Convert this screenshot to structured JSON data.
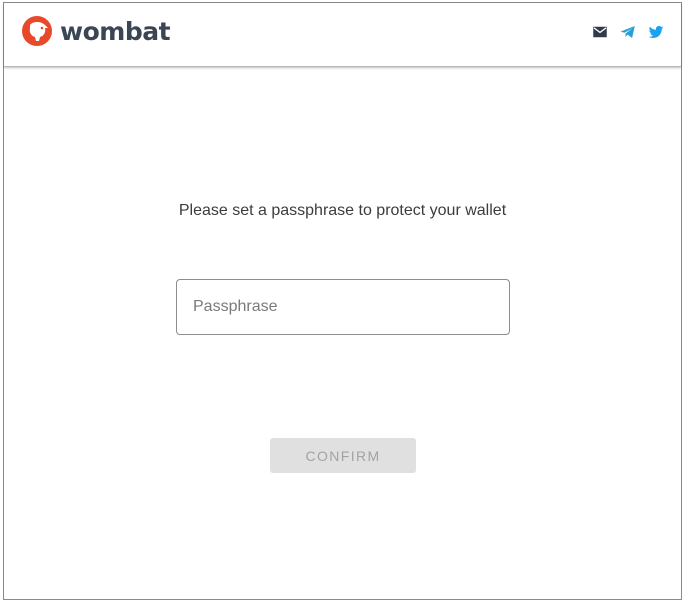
{
  "header": {
    "brand": "wombat",
    "social": [
      {
        "icon": "mail-icon",
        "color": "#2f3a4a"
      },
      {
        "icon": "telegram-icon",
        "color": "#2a9fd6"
      },
      {
        "icon": "twitter-icon",
        "color": "#1da1f2"
      }
    ]
  },
  "main": {
    "prompt": "Please set a passphrase to protect your wallet",
    "passphrase": {
      "placeholder": "Passphrase",
      "value": ""
    },
    "confirm_label": "CONFIRM",
    "confirm_enabled": false
  },
  "colors": {
    "brand_accent": "#e9492b",
    "brand_text": "#3b4654"
  }
}
